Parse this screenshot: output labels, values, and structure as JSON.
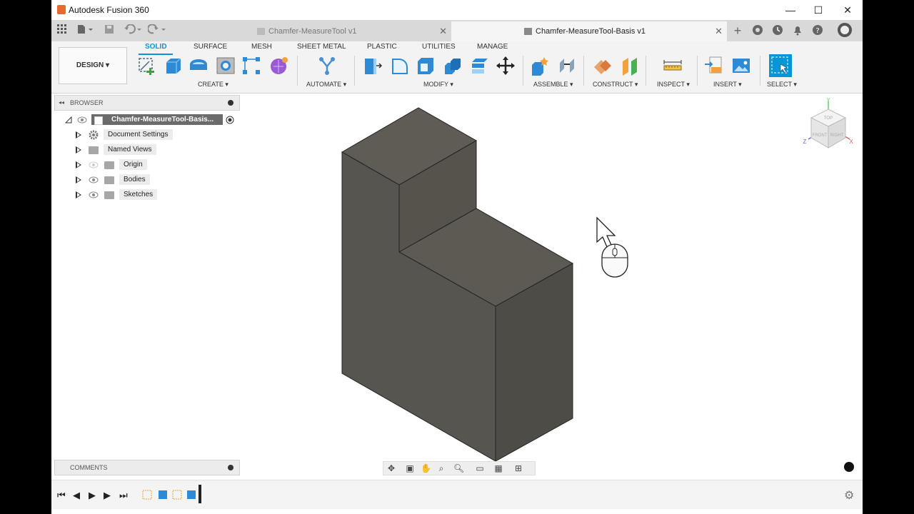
{
  "window": {
    "app_title": "Autodesk Fusion 360",
    "minimize": "—",
    "maximize": "☐",
    "close": "✕"
  },
  "tabs": [
    {
      "label": "Chamfer-MeasureTool v1",
      "active": false
    },
    {
      "label": "Chamfer-MeasureTool-Basis v1",
      "active": true
    }
  ],
  "ribbon": {
    "workspace": "DESIGN ▾",
    "tabs": [
      "SOLID",
      "SURFACE",
      "MESH",
      "SHEET METAL",
      "PLASTIC",
      "UTILITIES",
      "MANAGE"
    ],
    "groups": [
      "CREATE ▾",
      "AUTOMATE ▾",
      "MODIFY ▾",
      "ASSEMBLE ▾",
      "CONSTRUCT ▾",
      "INSPECT ▾",
      "INSERT ▾",
      "SELECT ▾"
    ]
  },
  "browser": {
    "title": "BROWSER",
    "root": "Chamfer-MeasureTool-Basis...",
    "items": [
      "Document Settings",
      "Named Views",
      "Origin",
      "Bodies",
      "Sketches"
    ]
  },
  "comments": {
    "title": "COMMENTS"
  },
  "viewcube": {
    "top": "TOP",
    "front": "FRONT",
    "right": "RIGHT",
    "axis_x": "X",
    "axis_y": "Y",
    "axis_z": "Z"
  },
  "colors": {
    "accent": "#0696d7",
    "body_face_top": "#5c5a52",
    "body_face_left": "#55534b",
    "body_face_right": "#4f4d46"
  }
}
